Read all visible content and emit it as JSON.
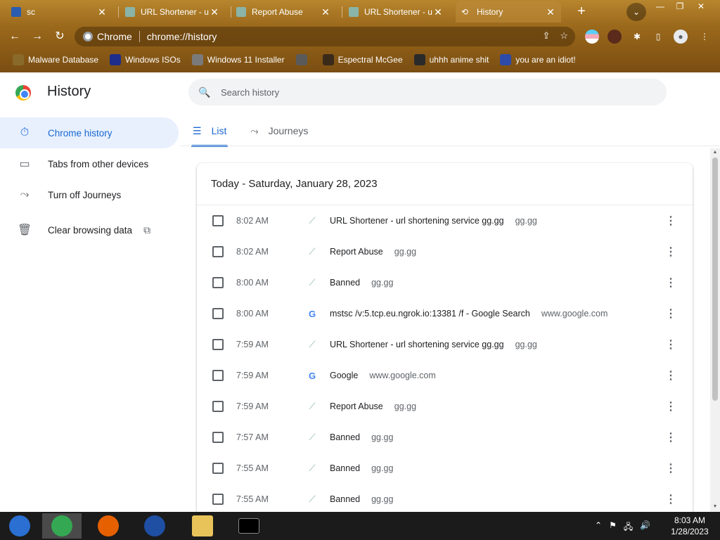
{
  "browser": {
    "tabs": [
      {
        "title": "sc",
        "active": false,
        "favicon": "sc-favicon"
      },
      {
        "title": "URL Shortener - u",
        "active": false,
        "favicon": "gg-favicon"
      },
      {
        "title": "Report Abuse",
        "active": false,
        "favicon": "gg-favicon"
      },
      {
        "title": "URL Shortener - u",
        "active": false,
        "favicon": "gg-favicon"
      },
      {
        "title": "History",
        "active": true,
        "favicon": "history-icon"
      }
    ],
    "close_glyph": "✕",
    "new_tab_glyph": "+",
    "tab_search_glyph": "⌄",
    "window_controls": {
      "minimize": "—",
      "maximize": "❐",
      "close": "✕"
    },
    "nav": {
      "back": "←",
      "forward": "→",
      "reload": "↻"
    },
    "omnibox": {
      "site_chip": "Chrome",
      "url": "chrome://history",
      "share_glyph": "⇪",
      "star_glyph": "☆"
    },
    "extension_glyphs": {
      "puzzle": "✱",
      "sidebar": "▯",
      "profile": "●",
      "menu": "⋮"
    },
    "bookmarks": [
      {
        "label": "Malware Database",
        "color": "#8a6a2a"
      },
      {
        "label": "Windows ISOs",
        "color": "#1e2d8a"
      },
      {
        "label": "Windows 11 Installer",
        "color": "#7a7a7a"
      },
      {
        "label": "",
        "color": "#5a5a5a"
      },
      {
        "label": "Espectral McGee",
        "color": "#3a2a1a"
      },
      {
        "label": "uhhh anime shit",
        "color": "#2a2a2a"
      },
      {
        "label": "you are an idiot!",
        "color": "#2d4aa8"
      }
    ],
    "colors": {
      "frame": "#9c6a1c",
      "accent": "#1967d2"
    }
  },
  "page": {
    "title": "History",
    "search_placeholder": "Search history",
    "search_glyph": "🔍",
    "sidebar": [
      {
        "label": "Chrome history",
        "icon": "⏱",
        "active": true
      },
      {
        "label": "Tabs from other devices",
        "icon": "▭",
        "active": false
      },
      {
        "label": "Turn off Journeys",
        "icon": "⤳",
        "active": false
      },
      {
        "label": "Clear browsing data",
        "icon": "🗑",
        "active": false,
        "external_glyph": "⧉"
      }
    ],
    "tabs": [
      {
        "label": "List",
        "icon": "☰",
        "active": true
      },
      {
        "label": "Journeys",
        "icon": "⤳",
        "active": false
      }
    ],
    "date_heading": "Today - Saturday, January 28, 2023",
    "more_glyph": "⋮",
    "entries": [
      {
        "time": "8:02 AM",
        "title": "URL Shortener - url shortening service gg.gg",
        "domain": "gg.gg",
        "favicon": "gg"
      },
      {
        "time": "8:02 AM",
        "title": "Report Abuse",
        "domain": "gg.gg",
        "favicon": "gg"
      },
      {
        "time": "8:00 AM",
        "title": "Banned",
        "domain": "gg.gg",
        "favicon": "gg"
      },
      {
        "time": "8:00 AM",
        "title": "mstsc /v:5.tcp.eu.ngrok.io:13381 /f - Google Search",
        "domain": "www.google.com",
        "favicon": "google"
      },
      {
        "time": "7:59 AM",
        "title": "URL Shortener - url shortening service gg.gg",
        "domain": "gg.gg",
        "favicon": "gg"
      },
      {
        "time": "7:59 AM",
        "title": "Google",
        "domain": "www.google.com",
        "favicon": "google"
      },
      {
        "time": "7:59 AM",
        "title": "Report Abuse",
        "domain": "gg.gg",
        "favicon": "gg"
      },
      {
        "time": "7:57 AM",
        "title": "Banned",
        "domain": "gg.gg",
        "favicon": "gg"
      },
      {
        "time": "7:55 AM",
        "title": "Banned",
        "domain": "gg.gg",
        "favicon": "gg"
      },
      {
        "time": "7:55 AM",
        "title": "Banned",
        "domain": "gg.gg",
        "favicon": "gg"
      }
    ],
    "favicon_glyphs": {
      "gg": "⟋",
      "google": "G"
    }
  },
  "taskbar": {
    "apps": [
      {
        "name": "virtualbox-icon",
        "color": "#2a6fd1"
      },
      {
        "name": "chrome-icon",
        "color": "#34a853"
      },
      {
        "name": "firefox-icon",
        "color": "#e66000"
      },
      {
        "name": "obama-logo-icon",
        "color": "#1e4fa3"
      },
      {
        "name": "file-explorer-icon",
        "color": "#e8c35a"
      },
      {
        "name": "terminal-icon",
        "color": "#000000"
      }
    ],
    "tray_glyphs": [
      "⌃",
      "⚑",
      "🖧",
      "🔊"
    ],
    "clock_time": "8:03 AM",
    "clock_date": "1/28/2023"
  }
}
